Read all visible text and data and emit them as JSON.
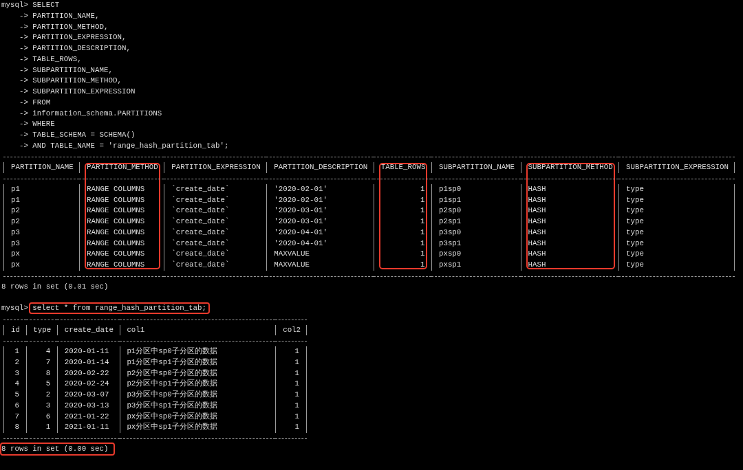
{
  "query": [
    {
      "prompt": "mysql>",
      "text": "SELECT"
    },
    {
      "prompt": "->",
      "text": "PARTITION_NAME,"
    },
    {
      "prompt": "->",
      "text": "PARTITION_METHOD,"
    },
    {
      "prompt": "->",
      "text": "PARTITION_EXPRESSION,"
    },
    {
      "prompt": "->",
      "text": "PARTITION_DESCRIPTION,"
    },
    {
      "prompt": "->",
      "text": "TABLE_ROWS,"
    },
    {
      "prompt": "->",
      "text": "SUBPARTITION_NAME,"
    },
    {
      "prompt": "->",
      "text": "SUBPARTITION_METHOD,"
    },
    {
      "prompt": "->",
      "text": "SUBPARTITION_EXPRESSION"
    },
    {
      "prompt": "->",
      "text": "FROM"
    },
    {
      "prompt": "->",
      "text": "information_schema.PARTITIONS"
    },
    {
      "prompt": "->",
      "text": "WHERE"
    },
    {
      "prompt": "->",
      "text": "TABLE_SCHEMA = SCHEMA()"
    },
    {
      "prompt": "->",
      "text": "AND TABLE_NAME = 'range_hash_partition_tab';"
    }
  ],
  "results": [
    {
      "columns": [
        {
          "name": "PARTITION_NAME",
          "numeric": false,
          "highlighted": false
        },
        {
          "name": "PARTITION_METHOD",
          "numeric": false,
          "highlighted": true
        },
        {
          "name": "PARTITION_EXPRESSION",
          "numeric": false,
          "highlighted": false
        },
        {
          "name": "PARTITION_DESCRIPTION",
          "numeric": false,
          "highlighted": false
        },
        {
          "name": "TABLE_ROWS",
          "numeric": true,
          "highlighted": true
        },
        {
          "name": "SUBPARTITION_NAME",
          "numeric": false,
          "highlighted": false
        },
        {
          "name": "SUBPARTITION_METHOD",
          "numeric": false,
          "highlighted": true
        },
        {
          "name": "SUBPARTITION_EXPRESSION",
          "numeric": false,
          "highlighted": false
        }
      ],
      "rows": [
        [
          "p1",
          "RANGE COLUMNS",
          "`create_date`",
          "'2020-02-01'",
          "1",
          "p1sp0",
          "HASH",
          "type"
        ],
        [
          "p1",
          "RANGE COLUMNS",
          "`create_date`",
          "'2020-02-01'",
          "1",
          "p1sp1",
          "HASH",
          "type"
        ],
        [
          "p2",
          "RANGE COLUMNS",
          "`create_date`",
          "'2020-03-01'",
          "1",
          "p2sp0",
          "HASH",
          "type"
        ],
        [
          "p2",
          "RANGE COLUMNS",
          "`create_date`",
          "'2020-03-01'",
          "1",
          "p2sp1",
          "HASH",
          "type"
        ],
        [
          "p3",
          "RANGE COLUMNS",
          "`create_date`",
          "'2020-04-01'",
          "1",
          "p3sp0",
          "HASH",
          "type"
        ],
        [
          "p3",
          "RANGE COLUMNS",
          "`create_date`",
          "'2020-04-01'",
          "1",
          "p3sp1",
          "HASH",
          "type"
        ],
        [
          "px",
          "RANGE COLUMNS",
          "`create_date`",
          "MAXVALUE",
          "1",
          "pxsp0",
          "HASH",
          "type"
        ],
        [
          "px",
          "RANGE COLUMNS",
          "`create_date`",
          "MAXVALUE",
          "1",
          "pxsp1",
          "HASH",
          "type"
        ]
      ],
      "status": {
        "text": "8 rows in set (0.01 sec)",
        "highlighted": false
      }
    },
    {
      "command": {
        "prompt": "mysql>",
        "text": "select * from range_hash_partition_tab;",
        "highlighted": true
      },
      "columns": [
        {
          "name": "id",
          "numeric": true,
          "highlighted": false
        },
        {
          "name": "type",
          "numeric": true,
          "highlighted": false
        },
        {
          "name": "create_date",
          "numeric": false,
          "highlighted": false
        },
        {
          "name": "col1",
          "numeric": false,
          "highlighted": false
        },
        {
          "name": "col2",
          "numeric": true,
          "highlighted": false
        }
      ],
      "rows": [
        [
          "1",
          "4",
          "2020-01-11",
          "p1分区中sp0子分区的数据",
          "1"
        ],
        [
          "2",
          "7",
          "2020-01-14",
          "p1分区中sp1子分区的数据",
          "1"
        ],
        [
          "3",
          "8",
          "2020-02-22",
          "p2分区中sp0子分区的数据",
          "1"
        ],
        [
          "4",
          "5",
          "2020-02-24",
          "p2分区中sp1子分区的数据",
          "1"
        ],
        [
          "5",
          "2",
          "2020-03-07",
          "p3分区中sp0子分区的数据",
          "1"
        ],
        [
          "6",
          "3",
          "2020-03-13",
          "p3分区中sp1子分区的数据",
          "1"
        ],
        [
          "7",
          "6",
          "2021-01-22",
          "px分区中sp0子分区的数据",
          "1"
        ],
        [
          "8",
          "1",
          "2021-01-11",
          "px分区中sp1子分区的数据",
          "1"
        ]
      ],
      "status": {
        "text": "8 rows in set (0.00 sec)",
        "highlighted": true
      }
    }
  ]
}
